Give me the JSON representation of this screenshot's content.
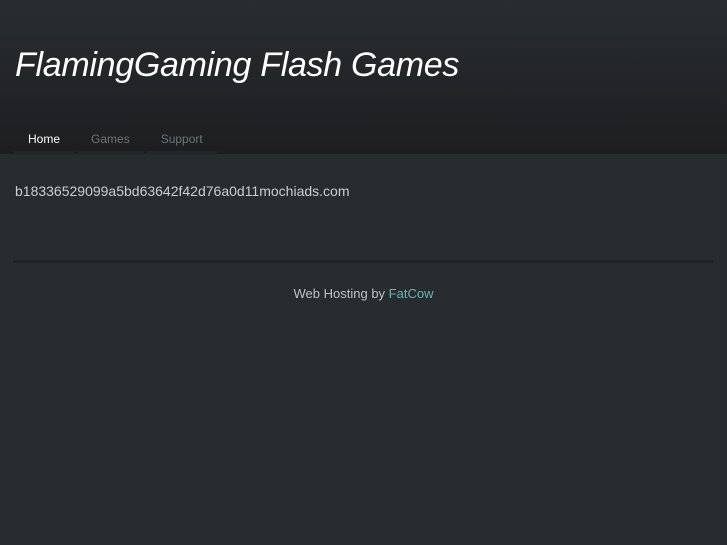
{
  "header": {
    "title": "FlamingGaming Flash Games"
  },
  "nav": [
    {
      "label": "Home"
    },
    {
      "label": "Games"
    },
    {
      "label": "Support"
    }
  ],
  "content": {
    "text": "b18336529099a5bd63642f42d76a0d11mochiads.com"
  },
  "footer": {
    "prefix": "Web Hosting by",
    "link": "FatCow"
  },
  "colors": {
    "link": "#5fb8ba",
    "background": "#292c2f"
  }
}
